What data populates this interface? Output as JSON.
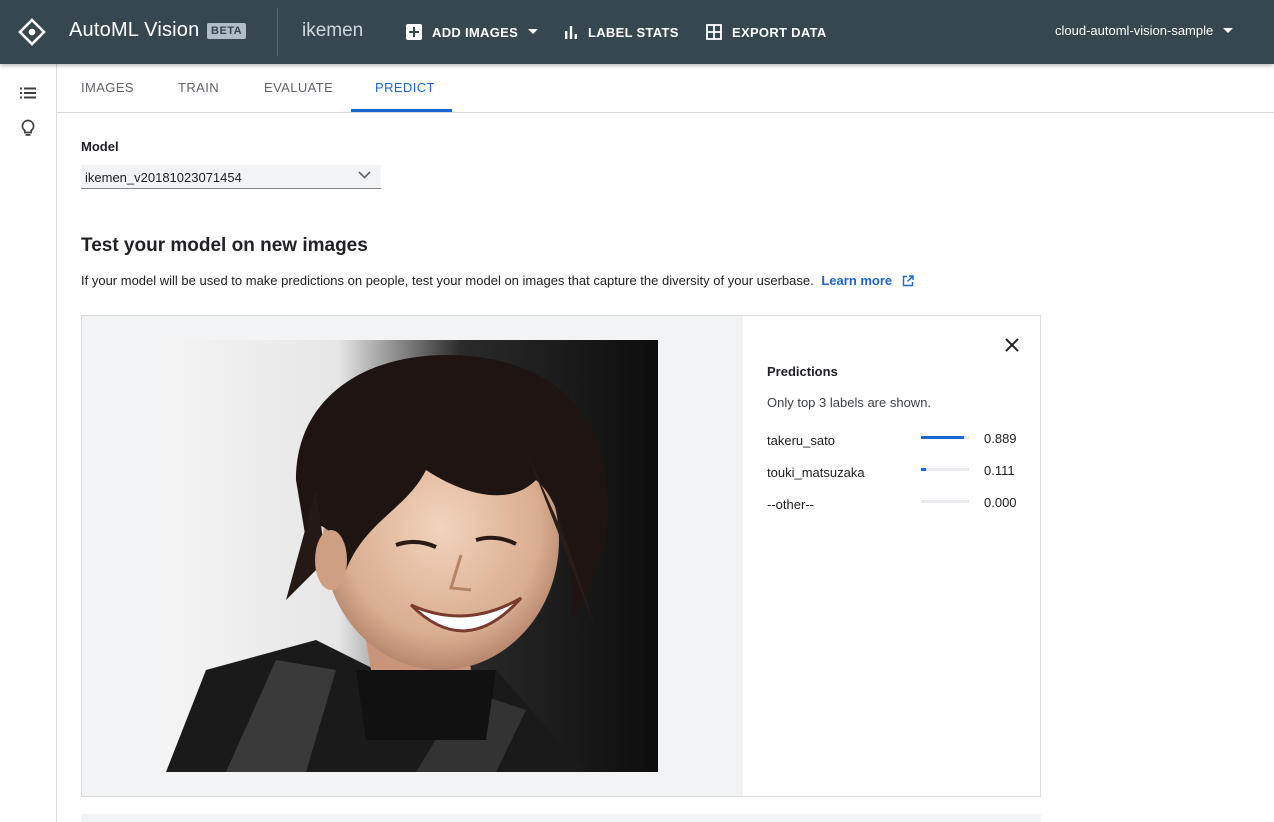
{
  "header": {
    "app_title": "AutoML Vision",
    "badge": "BETA",
    "project_name": "ikemen",
    "add_images_label": "ADD IMAGES",
    "label_stats_label": "LABEL STATS",
    "export_data_label": "EXPORT DATA",
    "account": "cloud-automl-vision-sample"
  },
  "sidebar": {
    "icons": [
      "list-icon",
      "lightbulb-icon"
    ]
  },
  "tabs": [
    {
      "label": "IMAGES",
      "active": false
    },
    {
      "label": "TRAIN",
      "active": false
    },
    {
      "label": "EVALUATE",
      "active": false
    },
    {
      "label": "PREDICT",
      "active": true
    }
  ],
  "model": {
    "label": "Model",
    "selected": "ikemen_v20181023071454"
  },
  "section": {
    "heading": "Test your model on new images",
    "description": "If your model will be used to make predictions on people, test your model on images that capture the diversity of your userbase.",
    "learn_more": "Learn more"
  },
  "predictions": {
    "title": "Predictions",
    "note": "Only top 3 labels are shown.",
    "items": [
      {
        "label": "takeru_sato",
        "score": "0.889",
        "value": 0.889
      },
      {
        "label": "touki_matsuzaka",
        "score": "0.111",
        "value": 0.111
      },
      {
        "label": "--other--",
        "score": "0.000",
        "value": 0.0
      }
    ]
  },
  "colors": {
    "topbar": "#37474f",
    "accent": "#1967d2"
  }
}
